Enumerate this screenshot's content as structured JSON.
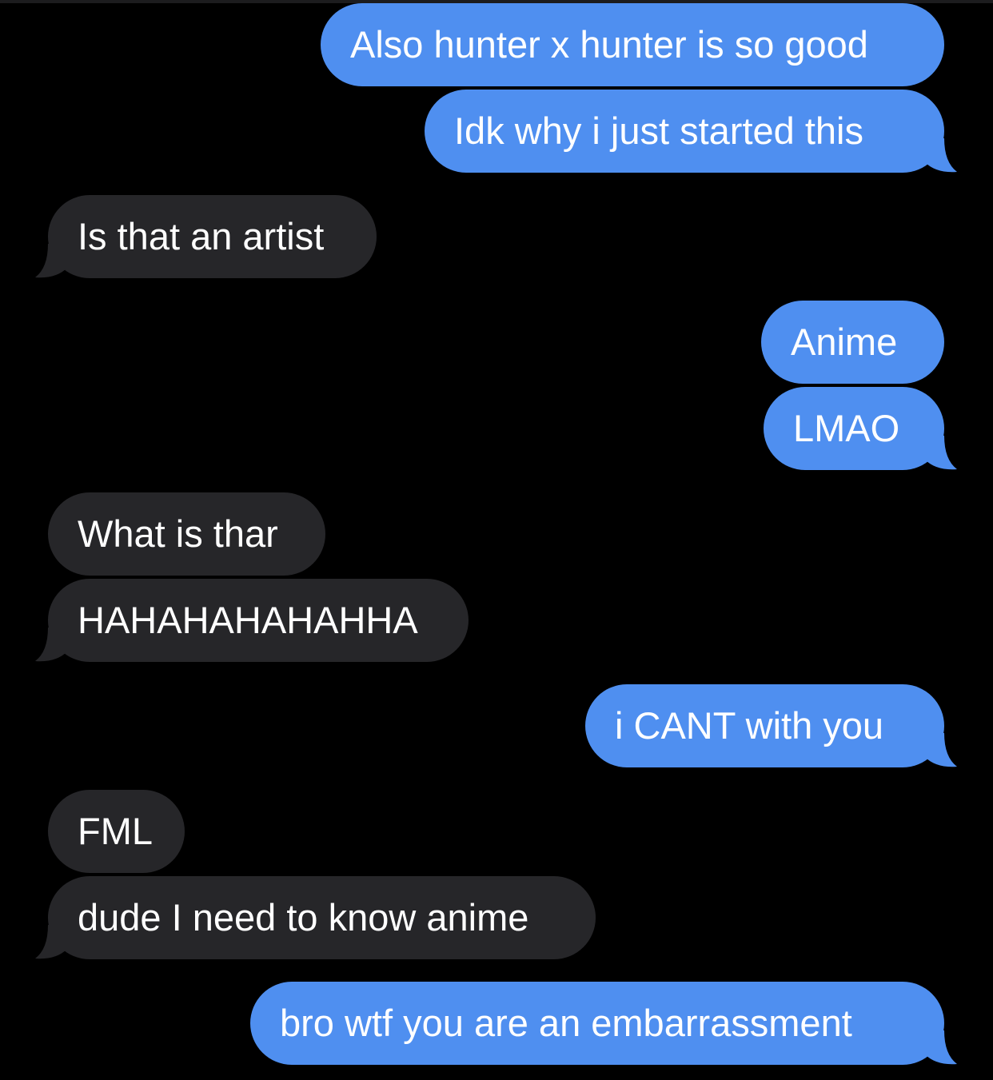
{
  "colors": {
    "background": "#000000",
    "sent_bubble": "#4f8ff0",
    "received_bubble": "#262629",
    "text": "#ffffff"
  },
  "messages": [
    {
      "direction": "sent",
      "text": "Also hunter x hunter is so good",
      "tail": false
    },
    {
      "direction": "sent",
      "text": "Idk why i just started this",
      "tail": true
    },
    {
      "direction": "received",
      "text": "Is that an artist",
      "tail": true
    },
    {
      "direction": "sent",
      "text": "Anime",
      "tail": false
    },
    {
      "direction": "sent",
      "text": "LMAO",
      "tail": true
    },
    {
      "direction": "received",
      "text": "What is thar",
      "tail": false
    },
    {
      "direction": "received",
      "text": "HAHAHAHAHAHHA",
      "tail": true
    },
    {
      "direction": "sent",
      "text": "i CANT with you",
      "tail": true
    },
    {
      "direction": "received",
      "text": "FML",
      "tail": false
    },
    {
      "direction": "received",
      "text": "dude I need to know anime",
      "tail": true
    },
    {
      "direction": "sent",
      "text": "bro wtf you are an embarrassment",
      "tail": true
    }
  ]
}
